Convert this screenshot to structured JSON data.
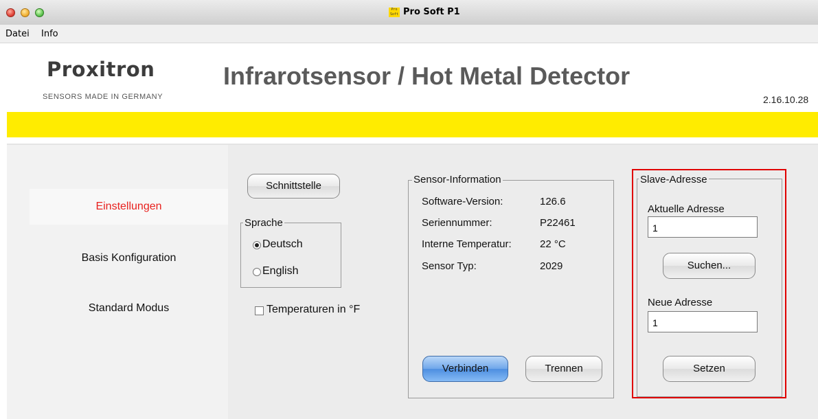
{
  "window": {
    "title": "Pro Soft P1",
    "app_icon_text": "Pro Soft"
  },
  "menu": {
    "items": [
      "Datei",
      "Info"
    ]
  },
  "header": {
    "logo": "Proxitron",
    "tagline": "SENSORS MADE IN GERMANY",
    "heading": "Infrarotsensor / Hot Metal Detector",
    "version": "2.16.10.28",
    "band_color": "#ffec00"
  },
  "nav": {
    "items": [
      {
        "label": "Einstellungen",
        "active": true
      },
      {
        "label": "Basis Konfiguration",
        "active": false
      },
      {
        "label": "Standard Modus",
        "active": false
      }
    ],
    "active_color": "#e8211e"
  },
  "settings": {
    "interface_button": "Schnittstelle",
    "language": {
      "legend": "Sprache",
      "options": [
        "Deutsch",
        "English"
      ],
      "selected": "Deutsch"
    },
    "fahrenheit": {
      "label": "Temperaturen in °F",
      "checked": false
    }
  },
  "sensor_info": {
    "legend": "Sensor-Information",
    "rows": [
      {
        "label": "Software-Version:",
        "value": "126.6"
      },
      {
        "label": "Seriennummer:",
        "value": "P22461"
      },
      {
        "label": "Interne Temperatur:",
        "value": "22 °C"
      },
      {
        "label": "Sensor Typ:",
        "value": "2029"
      }
    ],
    "connect_button": "Verbinden",
    "disconnect_button": "Trennen"
  },
  "slave": {
    "legend": "Slave-Adresse",
    "current_label": "Aktuelle Adresse",
    "current_value": "1",
    "search_button": "Suchen...",
    "new_label": "Neue Adresse",
    "new_value": "1",
    "set_button": "Setzen",
    "highlight_color": "#e00000"
  }
}
